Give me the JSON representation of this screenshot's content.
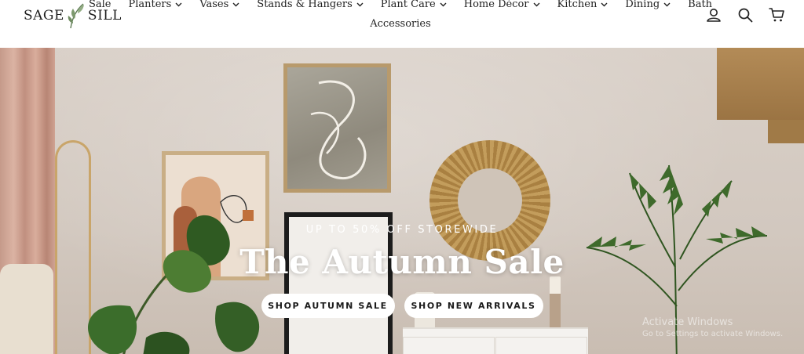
{
  "brand": {
    "name_left": "SAGE",
    "name_right": "SILL"
  },
  "nav": {
    "row1": [
      {
        "label": "Sale",
        "dropdown": false
      },
      {
        "label": "Planters",
        "dropdown": true
      },
      {
        "label": "Vases",
        "dropdown": true
      },
      {
        "label": "Stands & Hangers",
        "dropdown": true
      },
      {
        "label": "Plant Care",
        "dropdown": true
      },
      {
        "label": "Home Décor",
        "dropdown": true
      },
      {
        "label": "Kitchen",
        "dropdown": true
      },
      {
        "label": "Dining",
        "dropdown": true
      },
      {
        "label": "Bath",
        "dropdown": false
      }
    ],
    "row2": [
      {
        "label": "Accessories",
        "dropdown": false
      }
    ]
  },
  "header_icons": [
    "account-icon",
    "search-icon",
    "cart-icon"
  ],
  "hero": {
    "subtitle": "UP TO 50% OFF STOREWIDE",
    "title": "The Autumn Sale",
    "buttons": [
      {
        "label": "SHOP AUTUMN SALE"
      },
      {
        "label": "SHOP NEW ARRIVALS"
      }
    ]
  },
  "os_watermark": {
    "line1": "Activate Windows",
    "line2": "Go to Settings to activate Windows."
  },
  "colors": {
    "button_bg": "#ffffff",
    "hero_text": "#ffffff",
    "header_bg": "#ffffff",
    "nav_text": "#222222"
  }
}
